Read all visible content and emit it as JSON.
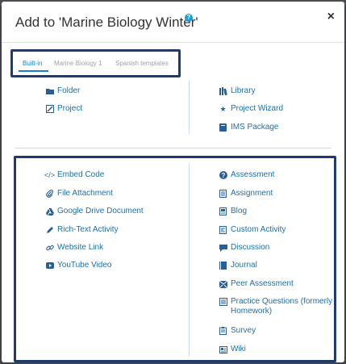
{
  "dialog": {
    "title": "Add to 'Marine Biology Winter'",
    "close_glyph": "×",
    "help_glyph": "?"
  },
  "tabs": [
    {
      "label": "Built-in",
      "active": true
    },
    {
      "label": "Marine Biology 1",
      "active": false
    },
    {
      "label": "Spanish templates",
      "active": false
    }
  ],
  "top_left": [
    {
      "label": "Folder",
      "icon": "folder-icon"
    },
    {
      "label": "Project",
      "icon": "project-icon"
    }
  ],
  "top_right": [
    {
      "label": "Library",
      "icon": "library-icon"
    },
    {
      "label": "Project Wizard",
      "icon": "star-icon"
    },
    {
      "label": "IMS Package",
      "icon": "package-icon"
    }
  ],
  "bottom_left": [
    {
      "label": "Embed Code",
      "icon": "code-icon"
    },
    {
      "label": "File Attachment",
      "icon": "paperclip-icon"
    },
    {
      "label": "Google Drive Document",
      "icon": "google-drive-icon"
    },
    {
      "label": "Rich-Text Activity",
      "icon": "pencil-icon"
    },
    {
      "label": "Website Link",
      "icon": "link-icon"
    },
    {
      "label": "YouTube Video",
      "icon": "youtube-icon"
    }
  ],
  "bottom_right": [
    {
      "label": "Assessment",
      "icon": "question-circle-icon"
    },
    {
      "label": "Assignment",
      "icon": "document-icon"
    },
    {
      "label": "Blog",
      "icon": "blog-icon"
    },
    {
      "label": "Custom Activity",
      "icon": "custom-activity-icon"
    },
    {
      "label": "Discussion",
      "icon": "discussion-icon"
    },
    {
      "label": "Journal",
      "icon": "journal-icon"
    },
    {
      "label": "Peer Assessment",
      "icon": "peer-assessment-icon"
    },
    {
      "label": "Practice Questions (formerly Homework)",
      "icon": "practice-questions-icon"
    },
    {
      "label": "Survey",
      "icon": "survey-icon"
    },
    {
      "label": "Wiki",
      "icon": "wiki-icon"
    }
  ],
  "colors": {
    "link": "#1a6fae",
    "tab_active": "#1a7fc4",
    "highlight_border": "#1f3a6e"
  }
}
